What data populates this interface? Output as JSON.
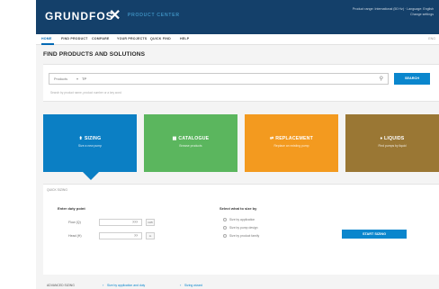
{
  "header": {
    "logo": "GRUNDFOS",
    "logo_mark": "✕",
    "app_name": "PRODUCT CENTER",
    "meta_line1": "Product range: International (50 Hz) · Language: English",
    "meta_line2": "Change settings"
  },
  "nav": {
    "items": [
      {
        "label": "HOME",
        "active": true
      },
      {
        "label": "FIND PRODUCT",
        "active": false
      },
      {
        "label": "COMPARE",
        "active": false
      },
      {
        "label": "YOUR PROJECTS",
        "active": false
      },
      {
        "label": "QUICK FIND",
        "active": false
      },
      {
        "label": "HELP",
        "active": false
      }
    ],
    "right_text": "ENG"
  },
  "page_title": "FIND PRODUCTS AND SOLUTIONS",
  "search": {
    "scope": "Products",
    "value": "TP",
    "button_label": "SEARCH",
    "hint": "Search by product name, product number or a key word"
  },
  "tiles": [
    {
      "title": "SIZING",
      "subtitle": "Size a new pump",
      "color": "#0b7fc4",
      "icon": "sizing-icon",
      "active": true
    },
    {
      "title": "CATALOGUE",
      "subtitle": "Browse products",
      "color": "#5bb65e",
      "icon": "catalogue-icon",
      "active": false
    },
    {
      "title": "REPLACEMENT",
      "subtitle": "Replace an existing pump",
      "color": "#f39a1f",
      "icon": "replacement-icon",
      "active": false
    },
    {
      "title": "LIQUIDS",
      "subtitle": "Find pumps by liquid",
      "color": "#9a7734",
      "icon": "liquids-icon",
      "active": false
    }
  ],
  "sizing": {
    "panel_label": "QUICK SIZING",
    "duty_heading": "Enter duty point",
    "flow_label": "Flow (Q)",
    "flow_value": "???",
    "flow_unit": "m³/h",
    "head_label": "Head (H)",
    "head_value": "??",
    "head_unit": "m",
    "method_heading": "Select what to size by",
    "options": [
      {
        "label": "Size by application"
      },
      {
        "label": "Size by pump design"
      },
      {
        "label": "Size by product family"
      }
    ],
    "start_label": "START SIZING"
  },
  "footer": {
    "label": "ADVANCED SIZING",
    "links": [
      {
        "label": "Size by application and duty",
        "icon": "arrow-icon"
      },
      {
        "label": "Sizing wizard",
        "icon": "arrow-icon"
      }
    ]
  }
}
